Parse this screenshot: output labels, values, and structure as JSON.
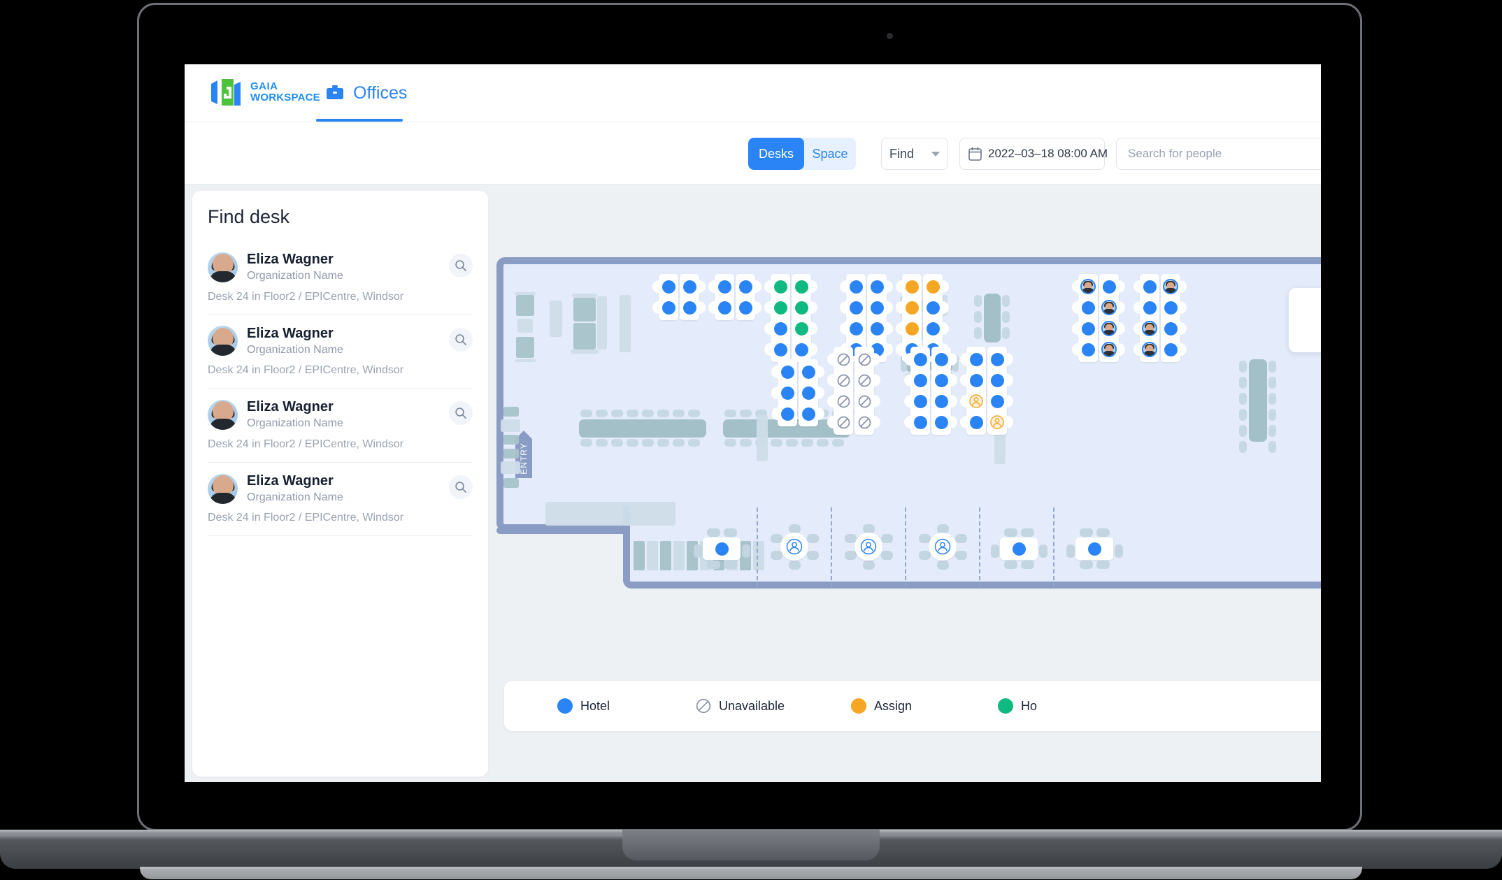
{
  "brand": {
    "line1": "GAIA",
    "line2": "WORKSPACE"
  },
  "nav": {
    "tab_label": "Offices",
    "tab_icon": "briefcase-icon"
  },
  "toolbar": {
    "view_desks": "Desks",
    "view_space": "Space",
    "find_label": "Find",
    "date_value": "2022–03–18 08:00 AM",
    "date_icon": "calendar-icon",
    "search_placeholder": "Search for people"
  },
  "sidebar": {
    "title": "Find desk",
    "people": [
      {
        "name": "Eliza Wagner",
        "org": "Organization Name",
        "location": "Desk 24 in Floor2 / EPICentre, Windsor",
        "action_icon": "search-icon"
      },
      {
        "name": "Eliza Wagner",
        "org": "Organization Name",
        "location": "Desk 24 in Floor2 / EPICentre, Windsor",
        "action_icon": "search-icon"
      },
      {
        "name": "Eliza Wagner",
        "org": "Organization Name",
        "location": "Desk 24 in Floor2 / EPICentre, Windsor",
        "action_icon": "search-icon"
      },
      {
        "name": "Eliza Wagner",
        "org": "Organization Name",
        "location": "Desk 24 in Floor2 / EPICentre, Windsor",
        "action_icon": "search-icon"
      }
    ]
  },
  "map": {
    "entry_label": "ENTRY"
  },
  "legend": {
    "items": [
      {
        "label": "Hotel",
        "color": "#2a84f5",
        "type": "dot"
      },
      {
        "label": "Unavailable",
        "color": "#8a93a8",
        "type": "blocked"
      },
      {
        "label": "Assign",
        "color": "#f5a623",
        "type": "dot"
      },
      {
        "label": "Ho",
        "color": "#10b981",
        "type": "dot"
      }
    ]
  },
  "colors": {
    "hotel": "#2a84f5",
    "assign": "#f5a623",
    "home": "#10b981",
    "unavailable": "#8a93a8",
    "accent": "#2a84f5",
    "wall": "#8a9cc4",
    "floor": "#e4ebfa"
  }
}
